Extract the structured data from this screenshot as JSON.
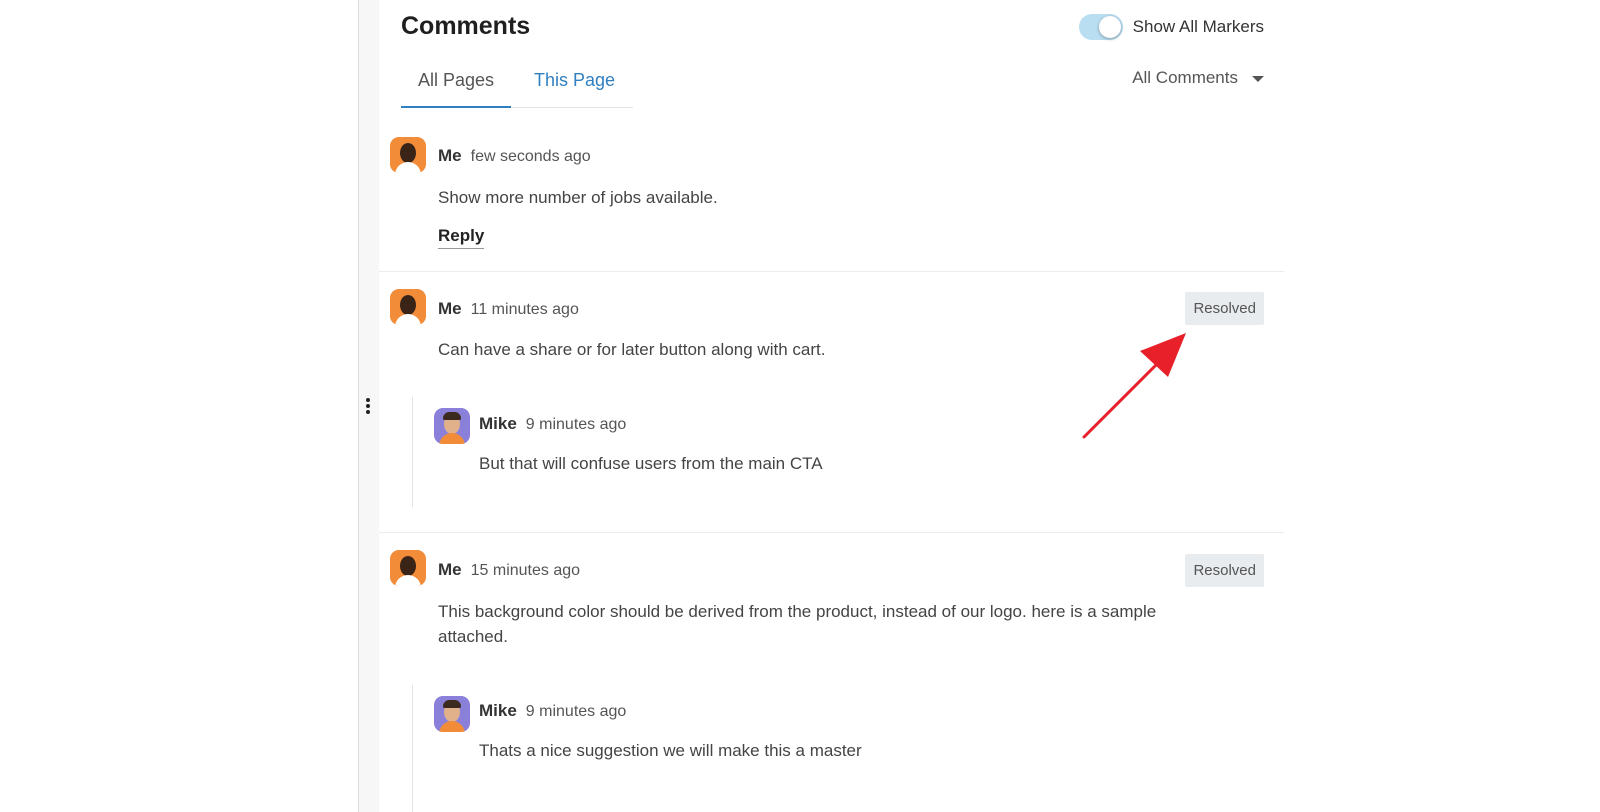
{
  "panel": {
    "title": "Comments",
    "show_markers_label": "Show All Markers",
    "show_markers_on": true,
    "tabs": [
      {
        "label": "All Pages",
        "active": true
      },
      {
        "label": "This Page",
        "active": false
      }
    ],
    "filter_label": "All Comments"
  },
  "comments": [
    {
      "author": "Me",
      "time": "few seconds ago",
      "text": "Show more number of jobs available.",
      "reply_label": "Reply"
    },
    {
      "author": "Me",
      "time": "11 minutes ago",
      "text": "Can have a share or for later button along with cart.",
      "status": "Resolved",
      "replies": [
        {
          "author": "Mike",
          "time": "9 minutes ago",
          "text": "But that will confuse users from the main CTA"
        }
      ]
    },
    {
      "author": "Me",
      "time": "15 minutes ago",
      "text": "This background color should be derived from the product, instead of our logo. here is a sample attached.",
      "status": "Resolved",
      "replies": [
        {
          "author": "Mike",
          "time": "9 minutes ago",
          "text": "Thats a nice suggestion we will make this a master"
        }
      ]
    }
  ],
  "icons": {
    "more": "vertical-ellipsis-icon",
    "caret": "caret-down-icon",
    "annotation": "red-arrow-icon"
  },
  "colors": {
    "accent": "#2f7fc1",
    "toggle_track": "#b9ddf1",
    "badge_bg": "#e8ecef",
    "annotation": "#e8202a"
  }
}
